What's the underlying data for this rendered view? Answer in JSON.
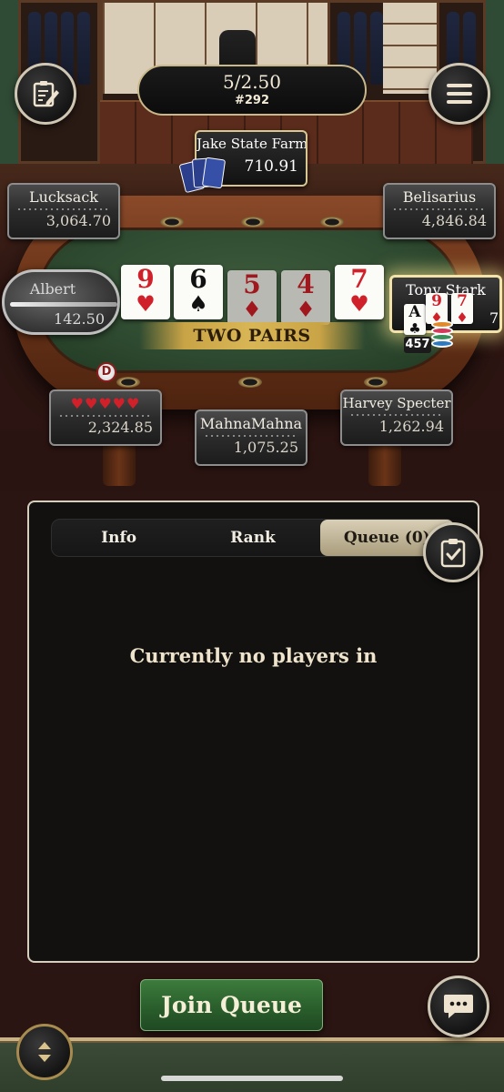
{
  "header": {
    "stakes": "5/2.50",
    "table_id": "#292"
  },
  "featured_player": {
    "name": "Jake State Farm",
    "chips": "710.91"
  },
  "players": {
    "lucksack": {
      "name": "Lucksack",
      "chips": "3,064.70"
    },
    "belisarius": {
      "name": "Belisarius",
      "chips": "4,846.84"
    },
    "albert": {
      "name": "Albert",
      "chips": "142.50"
    },
    "tony": {
      "name": "Tony Stark",
      "side_count": "457",
      "side_digit": "5",
      "suffix_digit": "7"
    },
    "hearts_player": {
      "name": "♥♥♥♥♥",
      "chips": "2,324.85"
    },
    "mahna": {
      "name": "MahnaMahna",
      "chips": "1,075.25"
    },
    "harvey": {
      "name": "Harvey Specter",
      "chips": "1,262.94"
    }
  },
  "board": {
    "cards": [
      {
        "rank": "9",
        "suit": "♥",
        "color": "red",
        "dim": false
      },
      {
        "rank": "6",
        "suit": "♠",
        "color": "black",
        "dim": false
      },
      {
        "rank": "5",
        "suit": "♦",
        "color": "red",
        "dim": true
      },
      {
        "rank": "4",
        "suit": "♦",
        "color": "red",
        "dim": true
      },
      {
        "rank": "7",
        "suit": "♥",
        "color": "red",
        "dim": false
      }
    ],
    "hand_label": "TWO PAIRS"
  },
  "tony_cards": [
    {
      "rank": "A",
      "suit": "♣",
      "color": "black"
    },
    {
      "rank": "9",
      "suit": "♦",
      "color": "red"
    },
    {
      "rank": "7",
      "suit": "♦",
      "color": "red"
    }
  ],
  "dealer_label": "D",
  "panel": {
    "tabs": [
      "Info",
      "Rank",
      "Queue (0)"
    ],
    "active_tab": 2,
    "empty_message": "Currently no players in"
  },
  "actions": {
    "join_queue": "Join Queue"
  },
  "icons": {
    "notes": "notes-icon",
    "menu": "hamburger-menu-icon",
    "clipboard": "clipboard-check-icon",
    "chat": "chat-bubble-icon",
    "sort": "sort-arrows-icon"
  },
  "colors": {
    "accent_gold": "#c9a446",
    "join_green": "#2a5e2c",
    "card_red": "#d0202a"
  }
}
